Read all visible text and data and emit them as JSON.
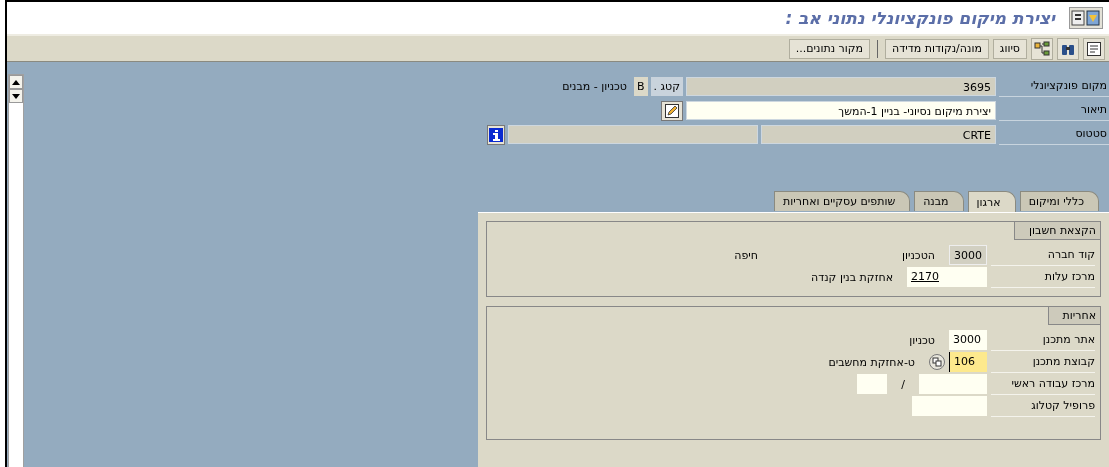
{
  "window": {
    "title": "יצירת מיקום פונקציונלי נתוני אב :"
  },
  "toolbar": {
    "buttons": [
      {
        "label": "סיווג"
      },
      {
        "label": "מונה/נקודות מדידה"
      },
      {
        "label": "מקור נתונים..."
      }
    ]
  },
  "header": {
    "location": {
      "label": "מקום פונקציונלי",
      "value": "3695"
    },
    "category": {
      "label": "קטג .",
      "value": "B",
      "text": "טכניון - מבנים"
    },
    "description": {
      "label": "תיאור",
      "value": "יצירת מיקום נסיוני- בניין 1-המשך"
    },
    "status": {
      "label": "סטטוס",
      "value": "CRTE"
    }
  },
  "tabs": [
    {
      "label": "כללי ומיקום",
      "selected": false
    },
    {
      "label": "ארגון",
      "selected": true
    },
    {
      "label": "מבנה",
      "selected": false
    },
    {
      "label": "שותפים עסקיים ואחריות",
      "selected": false
    }
  ],
  "groups": [
    {
      "title": "הקצאת חשבון",
      "rows": [
        {
          "kind": "field",
          "label": "קוד חברה",
          "value": "3000",
          "editable": false,
          "underlined": false,
          "focused": false,
          "help": false,
          "text": "הטכניון",
          "text_2": "חיפה"
        },
        {
          "kind": "field",
          "label": "מרכז עלות",
          "value": "2170",
          "editable": true,
          "underlined": true,
          "focused": false,
          "help": false,
          "text": "אחזקת בנין קנדה"
        }
      ]
    },
    {
      "title": "אחריות",
      "rows": [
        {
          "kind": "field",
          "label": "אתר מתכנן",
          "value": "3000",
          "editable": true,
          "underlined": false,
          "focused": false,
          "help": false,
          "text": "טכניון"
        },
        {
          "kind": "field",
          "label": "קבוצת מתכנן",
          "value": "106",
          "editable": true,
          "underlined": false,
          "focused": true,
          "help": true,
          "text": "ט-אחזקת מחשבים"
        },
        {
          "kind": "pair",
          "label": "מרכז עבודה ראשי",
          "separator": "/"
        },
        {
          "kind": "empty",
          "label": "פרופיל קטלוג"
        }
      ]
    }
  ]
}
